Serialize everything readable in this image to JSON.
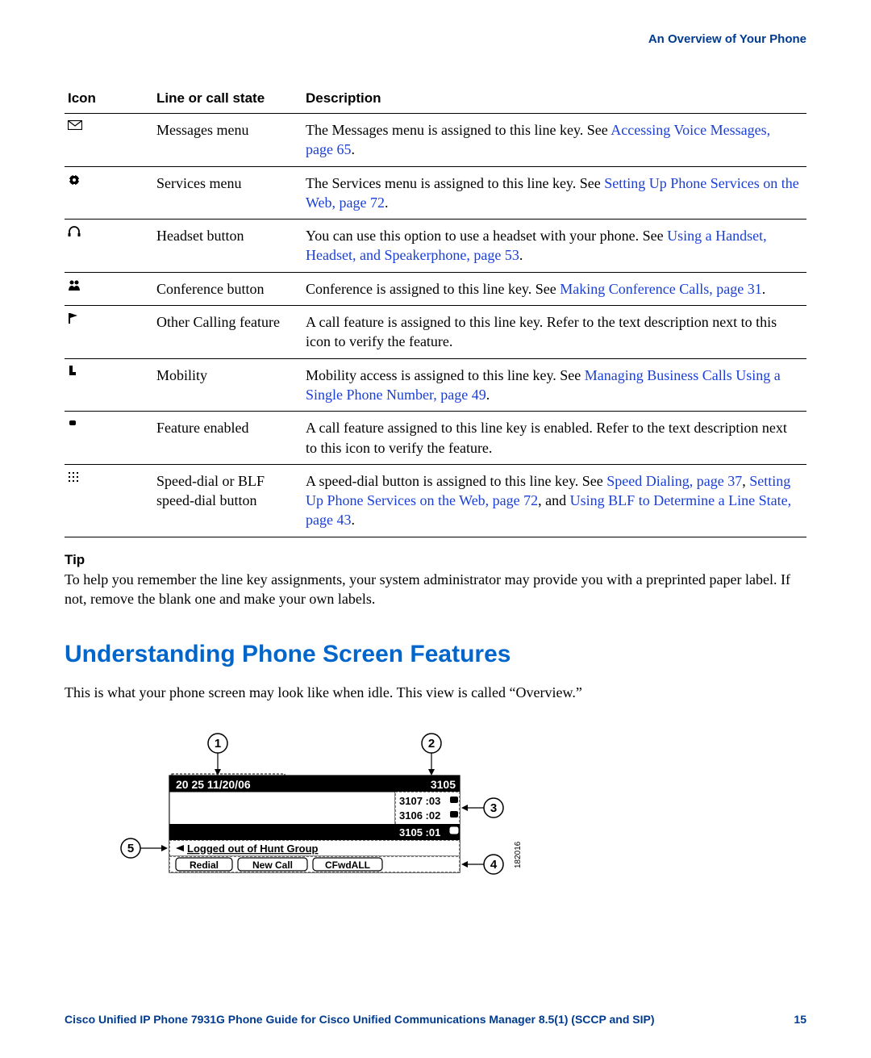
{
  "header": {
    "right": "An Overview of Your Phone"
  },
  "table": {
    "headers": {
      "icon": "Icon",
      "state": "Line or call state",
      "desc": "Description"
    },
    "rows": [
      {
        "state": "Messages menu",
        "desc_pre": "The Messages menu is assigned to this line key. See ",
        "link1": "Accessing Voice Messages, page 65",
        "desc_mid": "",
        "link2": "",
        "desc_mid2": "",
        "link3": "",
        "desc_post": "."
      },
      {
        "state": "Services menu",
        "desc_pre": "The Services menu is assigned to this line key. See ",
        "link1": "Setting Up Phone Services on the Web, page 72",
        "desc_mid": "",
        "link2": "",
        "desc_mid2": "",
        "link3": "",
        "desc_post": "."
      },
      {
        "state": "Headset button",
        "desc_pre": "You can use this option to use a headset with your phone. See ",
        "link1": "Using a Handset, Headset, and Speakerphone, page 53",
        "desc_mid": "",
        "link2": "",
        "desc_mid2": "",
        "link3": "",
        "desc_post": "."
      },
      {
        "state": "Conference button",
        "desc_pre": "Conference is assigned to this line key. See ",
        "link1": "Making Conference Calls, page 31",
        "desc_mid": "",
        "link2": "",
        "desc_mid2": "",
        "link3": "",
        "desc_post": "."
      },
      {
        "state": "Other Calling feature",
        "desc_pre": "A call feature is assigned to this line key. Refer to the text description next to this icon to verify the feature.",
        "link1": "",
        "desc_mid": "",
        "link2": "",
        "desc_mid2": "",
        "link3": "",
        "desc_post": ""
      },
      {
        "state": "Mobility",
        "desc_pre": "Mobility access is assigned to this line key. See ",
        "link1": "Managing Business Calls Using a Single Phone Number, page 49",
        "desc_mid": "",
        "link2": "",
        "desc_mid2": "",
        "link3": "",
        "desc_post": "."
      },
      {
        "state": "Feature enabled",
        "desc_pre": "A call feature assigned to this line key is enabled. Refer to the text description next to this icon to verify the feature.",
        "link1": "",
        "desc_mid": "",
        "link2": "",
        "desc_mid2": "",
        "link3": "",
        "desc_post": ""
      },
      {
        "state": "Speed-dial or BLF speed-dial button",
        "desc_pre": "A speed-dial button is assigned to this line key. See ",
        "link1": "Speed Dialing, page 37",
        "desc_mid": ", ",
        "link2": "Setting Up Phone Services on the Web, page 72",
        "desc_mid2": ", and ",
        "link3": "Using BLF to Determine a Line State, page 43",
        "desc_post": "."
      }
    ]
  },
  "tip": {
    "head": "Tip",
    "body": "To help you remember the line key assignments, your system administrator may provide you with a preprinted paper label. If not, remove the blank one and make your own labels."
  },
  "section": {
    "title": "Understanding Phone Screen Features",
    "intro": "This is what your phone screen may look like when idle. This view is called “Overview.”"
  },
  "figure": {
    "callouts": [
      "1",
      "2",
      "3",
      "4",
      "5"
    ],
    "header_left": "20 25 11/20/06",
    "header_right": "3105",
    "line1": "3107 :03",
    "line2": "3106 :02",
    "line3": "3105 :01",
    "status": "Logged out of Hunt Group",
    "softkeys": [
      "Redial",
      "New Call",
      "CFwdALL"
    ],
    "image_id": "182016"
  },
  "footer": {
    "title": "Cisco Unified IP Phone 7931G Phone Guide for Cisco Unified Communications Manager 8.5(1) (SCCP and SIP)",
    "page": "15"
  }
}
